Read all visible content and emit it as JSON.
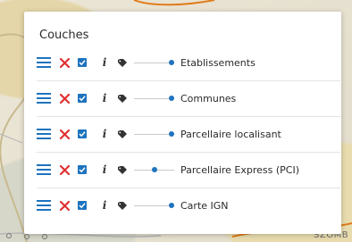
{
  "panel": {
    "title": "Couches",
    "layers": [
      {
        "name": "Etablissements",
        "opacity": 1.0,
        "visible": true
      },
      {
        "name": "Communes",
        "opacity": 1.0,
        "visible": true
      },
      {
        "name": "Parcellaire localisant",
        "opacity": 1.0,
        "visible": true
      },
      {
        "name": "Parcellaire Express (PCI)",
        "opacity": 0.5,
        "visible": true
      },
      {
        "name": "Carte IGN",
        "opacity": 1.0,
        "visible": true
      }
    ]
  },
  "map": {
    "labels": [
      "SZOMB"
    ]
  },
  "colors": {
    "menu": "#1e73be",
    "remove": "#e03030",
    "checkbox": "#1e73be",
    "slider_thumb": "#1e73be"
  },
  "icons": [
    "menu-icon",
    "remove-icon",
    "checkbox-icon",
    "info-icon",
    "tag-icon"
  ]
}
